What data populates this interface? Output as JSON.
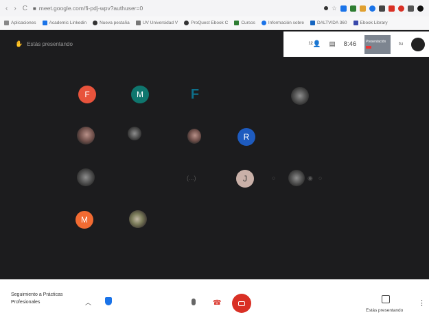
{
  "browser": {
    "url": "meet.google.com/fi-pdj-wpv?authuser=0",
    "bookmarks": [
      "Aplicaciones",
      "Academic Linkedin",
      "Nueva pestaña",
      "UV Universidad V",
      "ProQuest Ebook C",
      "Cursos",
      "Información sobre",
      "DALTVIDA 360",
      "Ebook Library"
    ]
  },
  "meet": {
    "presenting_label": "Estás presentando",
    "clock": "8:46",
    "self_label": "tu",
    "preview_label": "Presentación",
    "participants": [
      {
        "initial": "F",
        "color": "#e8533c"
      },
      {
        "initial": "M",
        "color": "#0f766e"
      },
      {
        "initial": "F",
        "color": "#0e4f66"
      },
      {
        "initial": "R",
        "color": "#1e5bbf"
      },
      {
        "initial": "J",
        "color": "#c9b0a8"
      },
      {
        "initial": "M",
        "color": "#f26b32"
      }
    ],
    "dim_label": "(...)"
  },
  "bottom": {
    "meeting_title": "Seguimiento a Prácticas Profesionales",
    "present_label": "Estás presentando"
  },
  "icons": {
    "mic": "mic-icon",
    "hangup": "hangup-icon",
    "camera_off": "camera-off-icon",
    "present": "present-icon",
    "more": "more-icon",
    "chevron": "chevron-up-icon",
    "shield": "shield-icon"
  }
}
